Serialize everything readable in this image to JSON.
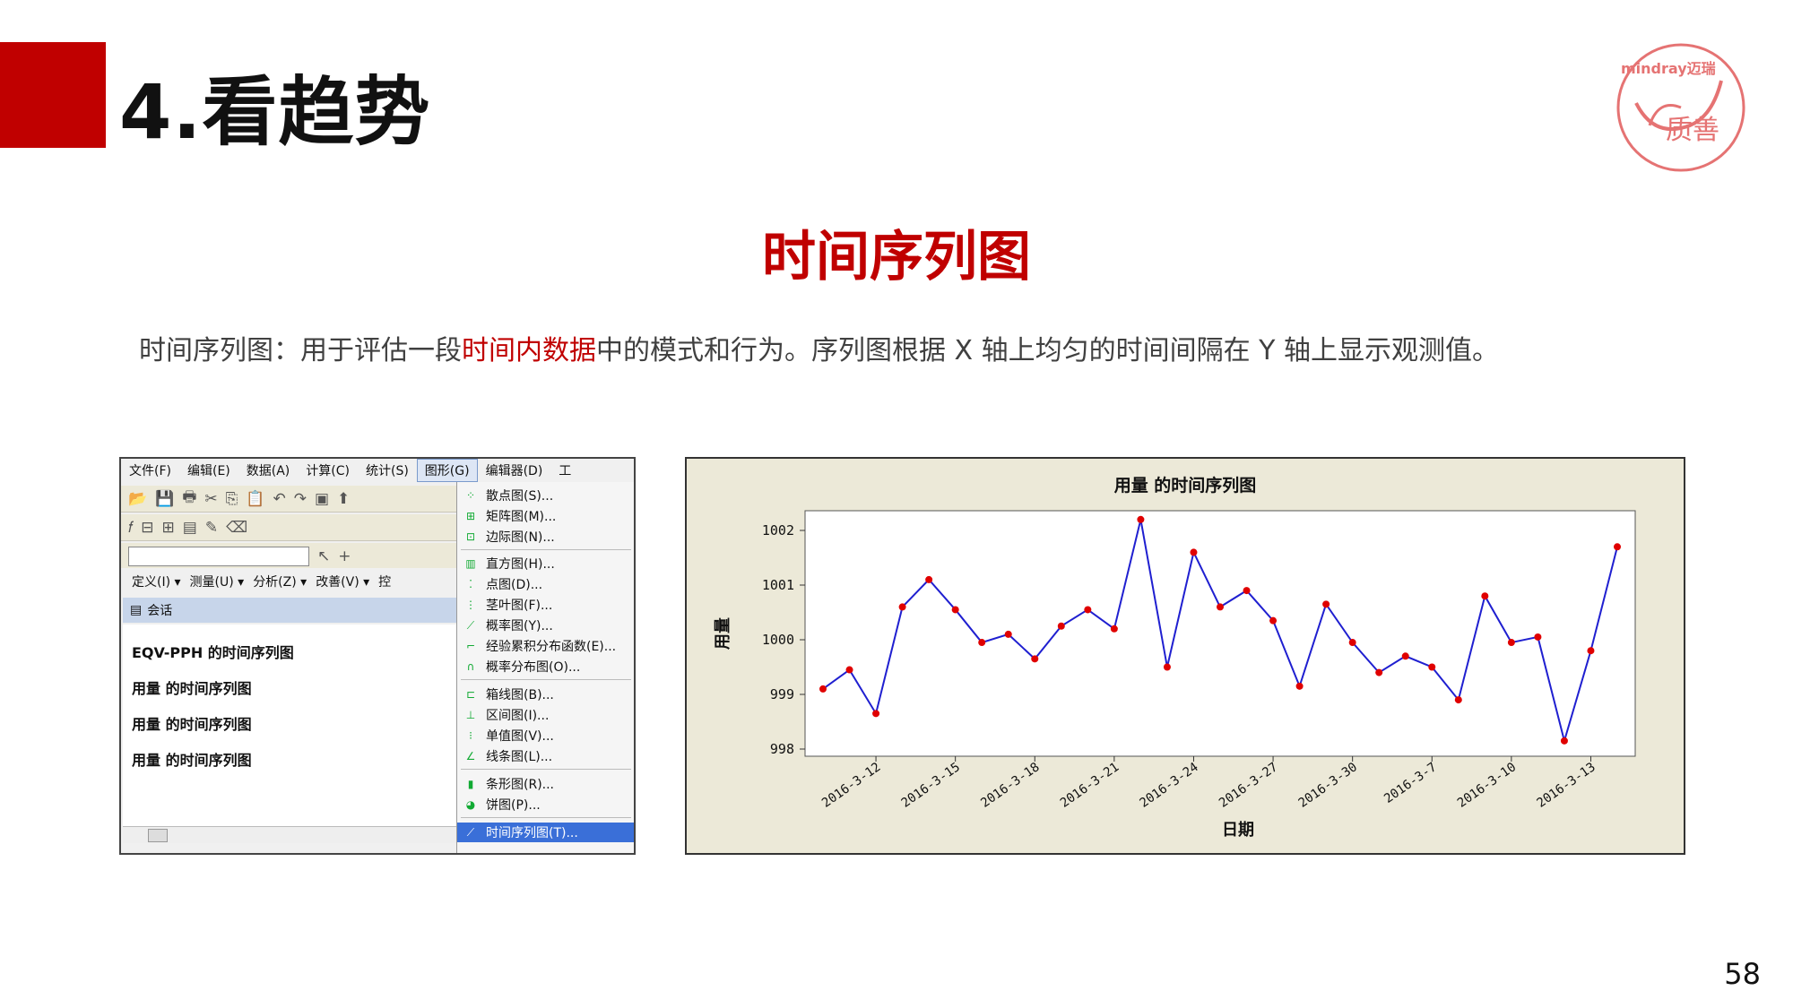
{
  "slide": {
    "title": "4.看趋势",
    "subtitle": "时间序列图",
    "desc_before": "时间序列图：用于评估一段",
    "desc_highlight": "时间内数据",
    "desc_after": "中的模式和行为。序列图根据 X 轴上均匀的时间间隔在 Y 轴上显示观测值。",
    "page_number": "58",
    "logo": {
      "brand": "mindray迈瑞",
      "text": "质善"
    },
    "accent_color": "#c00000"
  },
  "minitab": {
    "menubar": [
      "文件(F)",
      "编辑(E)",
      "数据(A)",
      "计算(C)",
      "统计(S)",
      "图形(G)",
      "编辑器(D)",
      "工"
    ],
    "active_menu": "图形(G)",
    "menubar3": [
      "定义(I) ▾",
      "测量(U) ▾",
      "分析(Z) ▾",
      "改善(V) ▾",
      "控"
    ],
    "session_title": "会话",
    "session_lines": [
      "EQV-PPH 的时间序列图",
      "用量  的时间序列图",
      "用量  的时间序列图",
      "用量  的时间序列图"
    ],
    "graph_menu": [
      {
        "label": "散点图(S)...",
        "icon": "scatter-icon"
      },
      {
        "label": "矩阵图(M)...",
        "icon": "matrix-icon"
      },
      {
        "label": "边际图(N)...",
        "icon": "marginal-icon"
      },
      {
        "label": "直方图(H)...",
        "icon": "histogram-icon"
      },
      {
        "label": "点图(D)...",
        "icon": "dotplot-icon"
      },
      {
        "label": "茎叶图(F)...",
        "icon": "stemleaf-icon"
      },
      {
        "label": "概率图(Y)...",
        "icon": "probability-icon"
      },
      {
        "label": "经验累积分布函数(E)...",
        "icon": "ecdf-icon"
      },
      {
        "label": "概率分布图(O)...",
        "icon": "distribution-icon"
      },
      {
        "label": "箱线图(B)...",
        "icon": "boxplot-icon"
      },
      {
        "label": "区间图(I)...",
        "icon": "interval-icon"
      },
      {
        "label": "单值图(V)...",
        "icon": "individual-icon"
      },
      {
        "label": "线条图(L)...",
        "icon": "lineplot-icon"
      },
      {
        "label": "条形图(R)...",
        "icon": "barchart-icon"
      },
      {
        "label": "饼图(P)...",
        "icon": "piechart-icon"
      },
      {
        "label": "时间序列图(T)...",
        "icon": "timeseries-icon"
      }
    ],
    "selected_item": "时间序列图(T)..."
  },
  "chart_data": {
    "type": "line",
    "title": "用量  的时间序列图",
    "xlabel": "日期",
    "ylabel": "用量",
    "ylim": [
      998,
      1002
    ],
    "yticks": [
      998,
      999,
      1000,
      1001,
      1002
    ],
    "xtick_labels": [
      "2016-3-12",
      "2016-3-15",
      "2016-3-18",
      "2016-3-21",
      "2016-3-24",
      "2016-3-27",
      "2016-3-30",
      "2016-3-7",
      "2016-3-10",
      "2016-3-13"
    ],
    "xtick_positions": [
      3,
      6,
      9,
      12,
      15,
      18,
      21,
      24,
      27,
      30
    ],
    "values": [
      999.1,
      999.45,
      998.65,
      1000.6,
      1001.1,
      1000.55,
      999.95,
      1000.1,
      999.65,
      1000.25,
      1000.55,
      1000.2,
      1002.2,
      999.5,
      1001.6,
      1000.6,
      1000.9,
      1000.35,
      999.15,
      1000.65,
      999.95,
      999.4,
      999.7,
      999.5,
      998.9,
      1000.8,
      999.95,
      1000.05,
      998.15,
      999.8,
      1001.7
    ],
    "line_color": "#1f1fd0",
    "marker_color": "#e00000",
    "grid": false
  }
}
